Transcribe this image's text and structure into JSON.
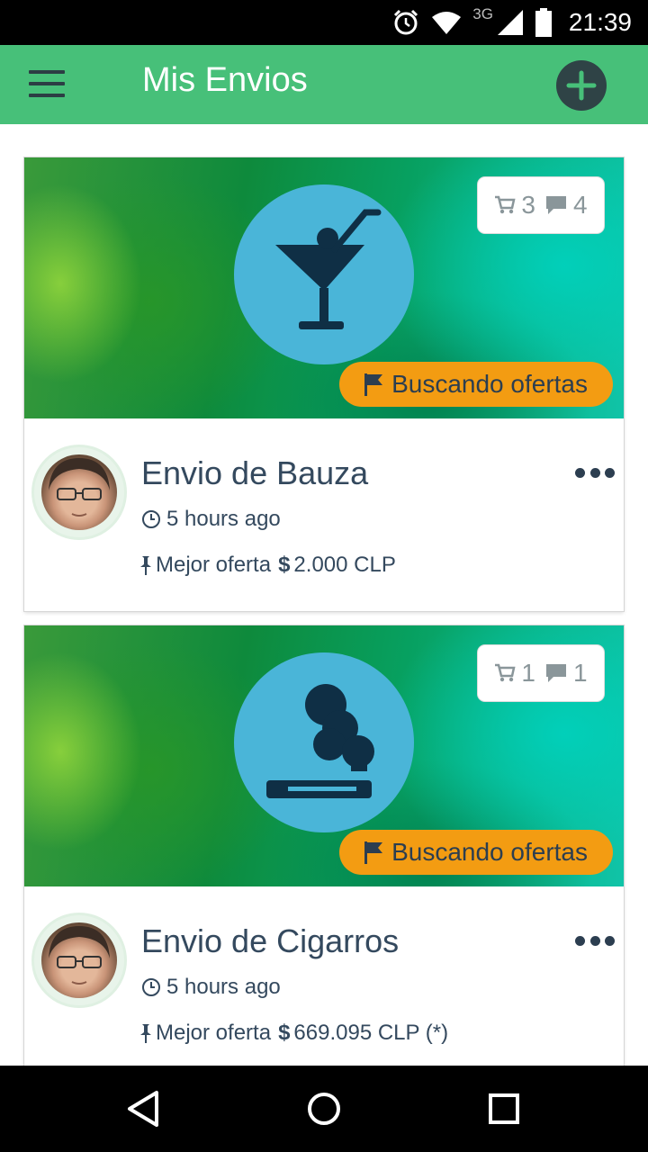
{
  "status_bar": {
    "time": "21:39",
    "network": "3G",
    "icons": [
      "alarm-icon",
      "wifi-icon",
      "signal-icon",
      "battery-icon"
    ]
  },
  "app_bar": {
    "title": "Mis Envios",
    "menu_icon": "hamburger-menu-icon",
    "add_icon": "plus-icon"
  },
  "cards": [
    {
      "category_icon": "cocktail-icon",
      "cart_count": "3",
      "comment_count": "4",
      "status": "Buscando ofertas",
      "title": "Envio de Bauza",
      "time": "5 hours ago",
      "offer_label": "Mejor oferta",
      "currency_symbol": "$",
      "offer_value": "2.000 CLP"
    },
    {
      "category_icon": "cigarette-icon",
      "cart_count": "1",
      "comment_count": "1",
      "status": "Buscando ofertas",
      "title": "Envio de Cigarros",
      "time": "5 hours ago",
      "offer_label": "Mejor oferta",
      "currency_symbol": "$",
      "offer_value": "669.095 CLP (*)"
    }
  ],
  "colors": {
    "app_bar": "#47c079",
    "status_pill": "#f39c12",
    "category_circle": "#4ab5d8",
    "text": "#34495e"
  },
  "nav_bar": {
    "icons": [
      "back-icon",
      "home-icon",
      "recents-icon"
    ]
  }
}
